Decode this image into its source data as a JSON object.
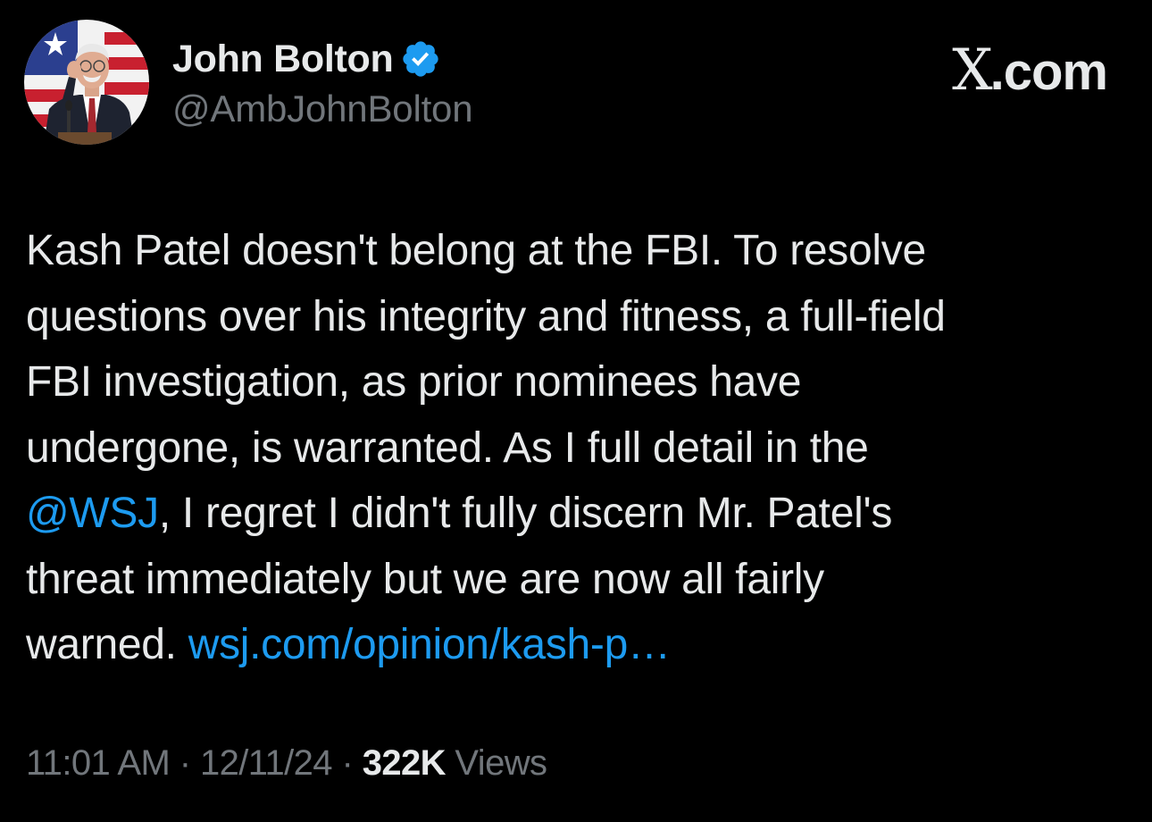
{
  "author": {
    "display_name": "John Bolton",
    "handle": "@AmbJohnBolton",
    "verified_icon": "verified-badge-icon",
    "avatar": "profile-photo-man-at-podium-flag-background",
    "badge_color": "#1d9bf0"
  },
  "brand": {
    "x": "X",
    "domain": ".com"
  },
  "tweet": {
    "lines": [
      {
        "text": "Kash Patel doesn't belong at the FBI. To resolve"
      },
      {
        "text": "questions over his integrity and fitness, a full-field"
      },
      {
        "text": "FBI investigation, as prior nominees have"
      },
      {
        "text": "undergone, is warranted. As I full detail in the"
      },
      {
        "mention": "@WSJ",
        "text": ", I regret I didn't fully discern Mr. Patel's"
      },
      {
        "text": "threat immediately but we are now all fairly"
      },
      {
        "text": "warned. ",
        "url": "wsj.com/opinion/kash-p…"
      }
    ],
    "link_color": "#1d9bf0"
  },
  "meta": {
    "time": "11:01 AM",
    "sep1": " · ",
    "date": "12/11/24",
    "sep2": " · ",
    "views_count": "322K",
    "views_label": " Views"
  }
}
